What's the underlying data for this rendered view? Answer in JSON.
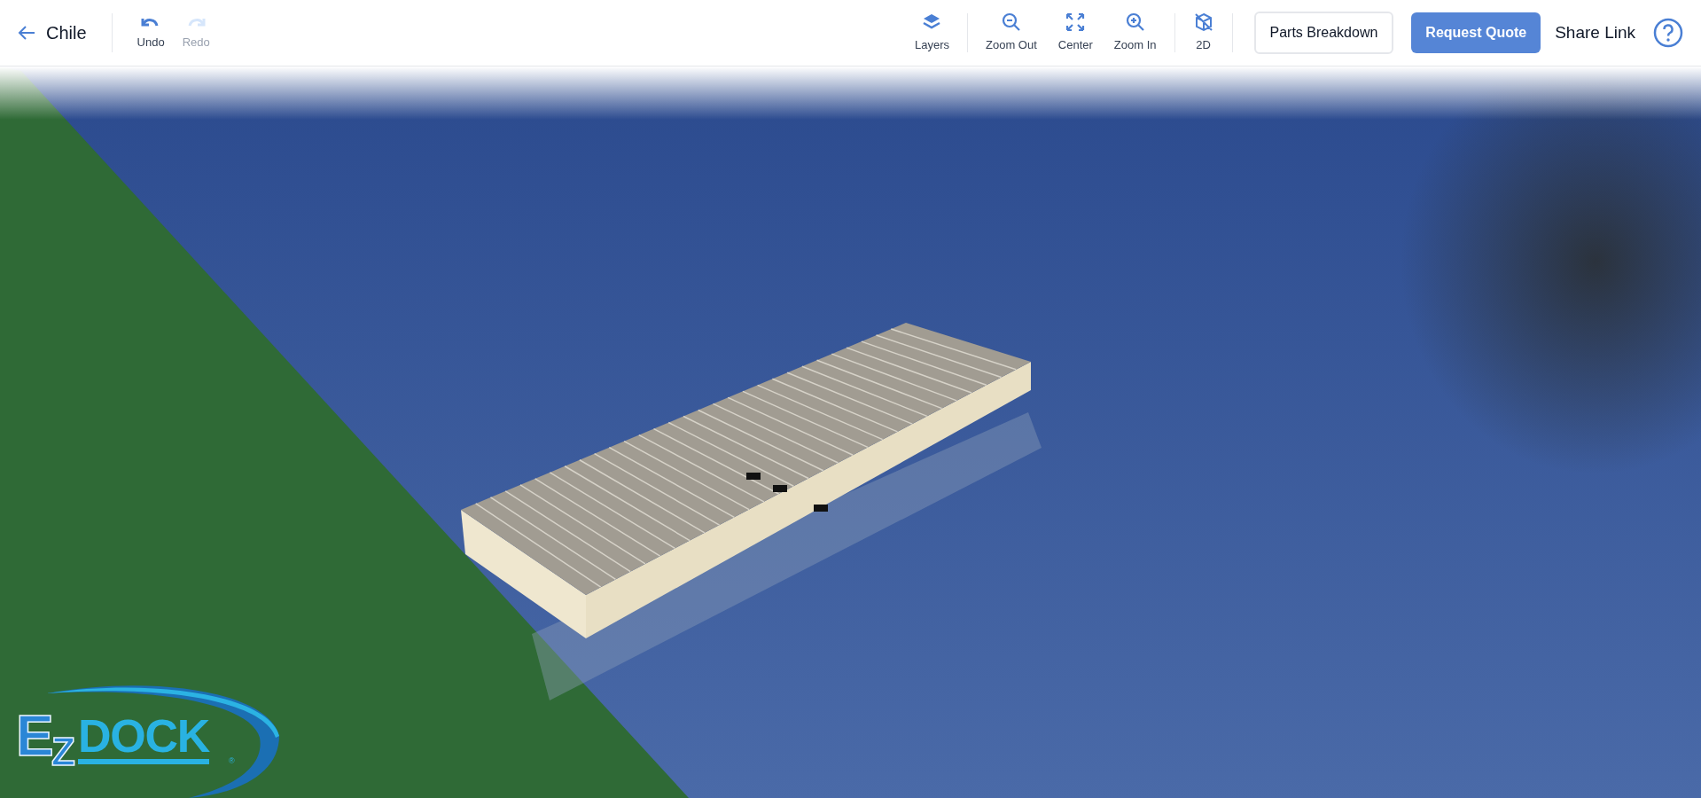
{
  "header": {
    "back_label": "Chile"
  },
  "history": [
    {
      "label": "Undo",
      "disabled": false
    },
    {
      "label": "Redo",
      "disabled": true
    }
  ],
  "tool_groups": [
    [
      {
        "label": "Layers"
      }
    ],
    [
      {
        "label": "Zoom Out"
      },
      {
        "label": "Center"
      },
      {
        "label": "Zoom In"
      }
    ],
    [
      {
        "label": "2D"
      }
    ]
  ],
  "buttons": [
    {
      "label": "Parts Breakdown",
      "kind": "outline"
    },
    {
      "label": "Request Quote",
      "kind": "primary"
    },
    {
      "label": "Share Link",
      "kind": "text"
    }
  ],
  "logo": {
    "letter_1": "E",
    "letter_2": "Z",
    "word": "DOCK",
    "mark": "®"
  }
}
